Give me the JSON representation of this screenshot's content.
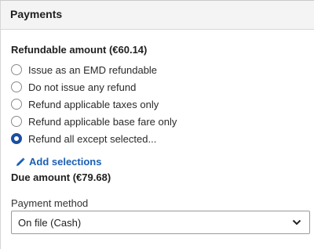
{
  "header": {
    "title": "Payments"
  },
  "refund": {
    "heading": "Refundable amount (€60.14)",
    "options": [
      {
        "label": "Issue as an EMD refundable",
        "checked": false
      },
      {
        "label": "Do not issue any refund",
        "checked": false
      },
      {
        "label": "Refund applicable taxes only",
        "checked": false
      },
      {
        "label": "Refund applicable base fare only",
        "checked": false
      },
      {
        "label": "Refund all except selected...",
        "checked": true
      }
    ],
    "add_selections_label": "Add selections",
    "add_selections_icon": "pencil-icon"
  },
  "due": {
    "label": "Due amount (€79.68)"
  },
  "payment_method": {
    "label": "Payment method",
    "selected": "On file (Cash)",
    "dropdown_icon": "chevron-down-icon"
  },
  "colors": {
    "accent": "#1a4fa0",
    "link": "#1a5fb4",
    "header_bg": "#f4f4f4"
  }
}
